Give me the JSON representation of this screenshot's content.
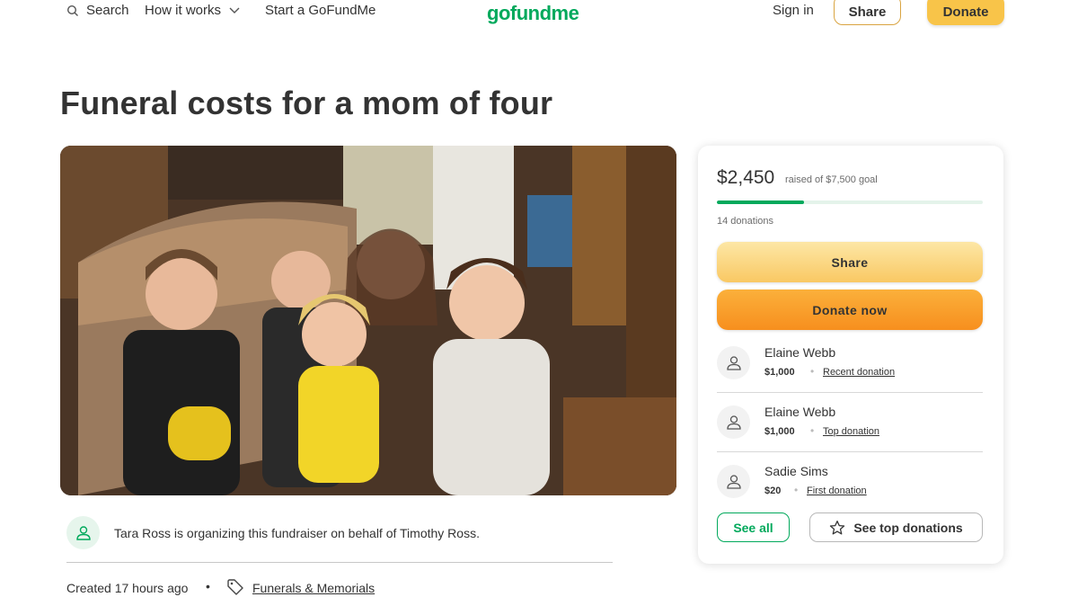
{
  "header": {
    "search_label": "Search",
    "how_it_works_label": "How it works",
    "start_label": "Start a GoFundMe",
    "logo_text": "gofundme",
    "sign_in_label": "Sign in",
    "share_label": "Share",
    "donate_label": "Donate"
  },
  "campaign": {
    "title": "Funeral costs for a mom of four",
    "organizer_text": "Tara Ross is organizing this fundraiser on behalf of Timothy Ross.",
    "created_text": "Created 17 hours ago",
    "category": "Funerals & Memorials"
  },
  "donation_card": {
    "raised_amount": "$2,450",
    "raised_goal_text": "raised of $7,500 goal",
    "progress_fraction": 0.3267,
    "donation_count": "14 donations",
    "share_button": "Share",
    "donate_button": "Donate now",
    "donors": [
      {
        "name": "Elaine Webb",
        "amount": "$1,000",
        "type": "Recent donation"
      },
      {
        "name": "Elaine Webb",
        "amount": "$1,000",
        "type": "Top donation"
      },
      {
        "name": "Sadie Sims",
        "amount": "$20",
        "type": "First donation"
      }
    ],
    "see_all_label": "See all",
    "see_top_label": "See top donations"
  },
  "colors": {
    "brand_green": "#02a95c",
    "donate_orange": "#f78f1e",
    "share_yellow": "#f9c863"
  },
  "icons": {
    "search": "search-icon",
    "chevron": "chevron-down-icon",
    "user": "user-heart-icon",
    "tag": "tag-icon",
    "star": "star-icon"
  }
}
